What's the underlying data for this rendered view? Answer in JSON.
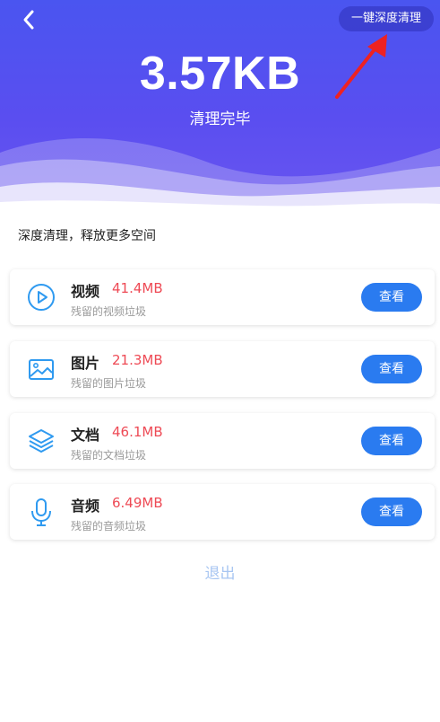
{
  "header": {
    "deep_clean_label": "一键深度清理",
    "size_value": "3.57KB",
    "status": "清理完毕"
  },
  "section": {
    "subtitle": "深度清理，释放更多空间"
  },
  "items": [
    {
      "title": "视频",
      "size": "41.4MB",
      "desc": "残留的视频垃圾",
      "button": "查看",
      "icon": "play-circle-icon"
    },
    {
      "title": "图片",
      "size": "21.3MB",
      "desc": "残留的图片垃圾",
      "button": "查看",
      "icon": "image-icon"
    },
    {
      "title": "文档",
      "size": "46.1MB",
      "desc": "残留的文档垃圾",
      "button": "查看",
      "icon": "layers-icon"
    },
    {
      "title": "音频",
      "size": "6.49MB",
      "desc": "残留的音频垃圾",
      "button": "查看",
      "icon": "microphone-icon"
    }
  ],
  "footer": {
    "exit_label": "退出"
  },
  "colors": {
    "header_gradient_top": "#4a55f0",
    "header_gradient_bottom": "#6a55ef",
    "size_red": "#ee4a55",
    "button_blue": "#2a7bf0",
    "icon_blue": "#2f9af0",
    "exit_text": "#a8c6f2"
  }
}
